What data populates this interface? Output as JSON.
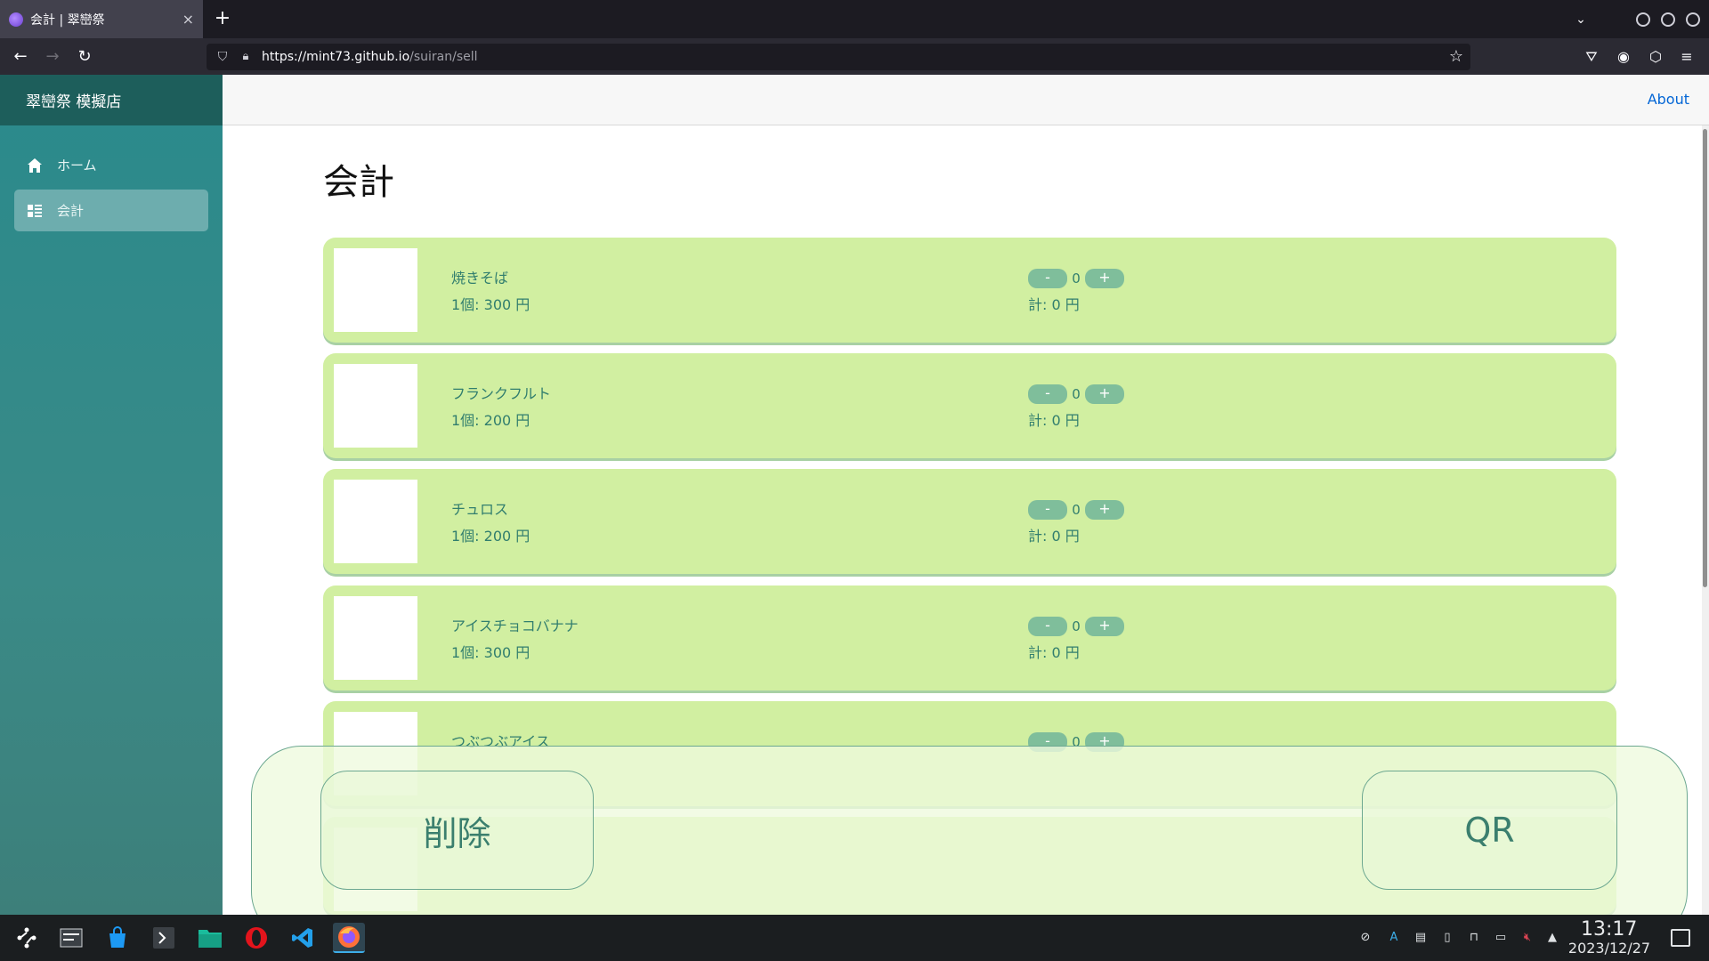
{
  "browser": {
    "tab_title": "会計 | 翠巒祭",
    "tab_close": "×",
    "new_tab": "+",
    "url_host": "https://mint73.github.io",
    "url_path": "/suiran/sell"
  },
  "sidebar": {
    "brand": "翠巒祭 模擬店",
    "items": [
      {
        "label": "ホーム",
        "icon": "home-icon"
      },
      {
        "label": "会計",
        "icon": "list-icon"
      }
    ]
  },
  "topbar": {
    "about": "About"
  },
  "main": {
    "title": "会計",
    "items": [
      {
        "name": "焼きそば",
        "price": "1個: 300 円",
        "count": "0",
        "total": "計: 0 円"
      },
      {
        "name": "フランクフルト",
        "price": "1個: 200 円",
        "count": "0",
        "total": "計: 0 円"
      },
      {
        "name": "チュロス",
        "price": "1個: 200 円",
        "count": "0",
        "total": "計: 0 円"
      },
      {
        "name": "アイスチョコバナナ",
        "price": "1個: 300 円",
        "count": "0",
        "total": "計: 0 円"
      },
      {
        "name": "つぶつぶアイス",
        "price": "",
        "count": "0",
        "total": ""
      }
    ],
    "minus": "-",
    "plus": "+"
  },
  "actions": {
    "delete": "削除",
    "qr": "QR"
  },
  "taskbar": {
    "time": "13:17",
    "date": "2023/12/27"
  }
}
